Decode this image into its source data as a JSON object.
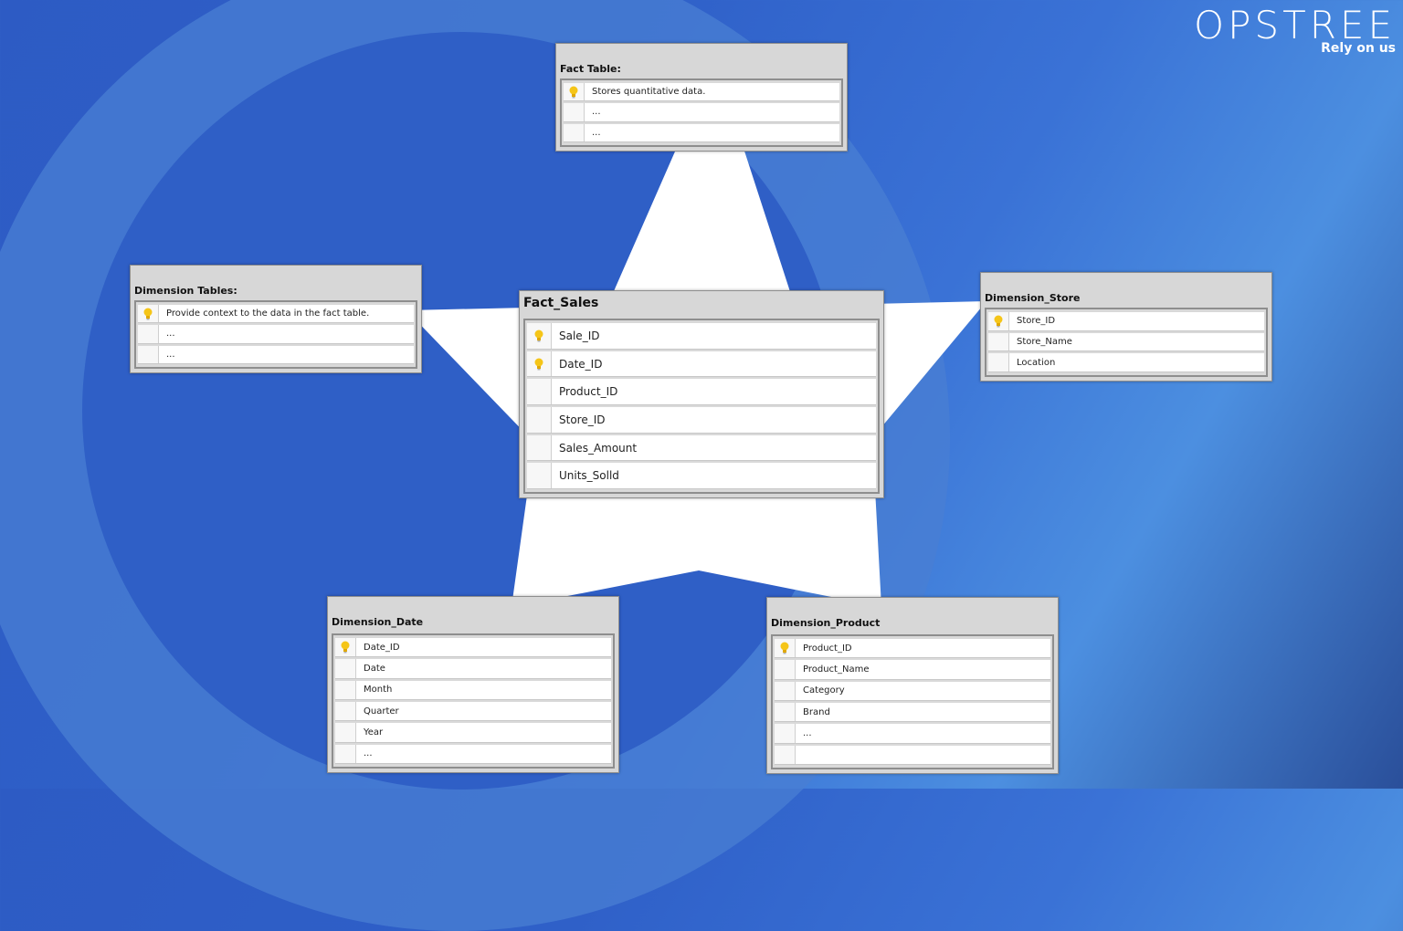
{
  "brand": {
    "name": "OPSTREE",
    "tagline": "Rely on us"
  },
  "diagram": {
    "fact_table_note": {
      "title": "Fact Table:",
      "rows": [
        {
          "key": true,
          "text": "Stores quantitative data."
        },
        {
          "key": false,
          "text": "..."
        },
        {
          "key": false,
          "text": "..."
        }
      ]
    },
    "dimension_tables_note": {
      "title": "Dimension Tables:",
      "rows": [
        {
          "key": true,
          "text": "Provide context to the data in the fact table."
        },
        {
          "key": false,
          "text": "..."
        },
        {
          "key": false,
          "text": "..."
        }
      ]
    },
    "fact_sales": {
      "title": "Fact_Sales",
      "rows": [
        {
          "key": true,
          "text": "Sale_ID"
        },
        {
          "key": true,
          "text": "Date_ID"
        },
        {
          "key": false,
          "text": "Product_ID"
        },
        {
          "key": false,
          "text": "Store_ID"
        },
        {
          "key": false,
          "text": "Sales_Amount"
        },
        {
          "key": false,
          "text": "Units_Solld"
        }
      ]
    },
    "dimension_store": {
      "title": "Dimension_Store",
      "rows": [
        {
          "key": true,
          "text": "Store_ID"
        },
        {
          "key": false,
          "text": "Store_Name"
        },
        {
          "key": false,
          "text": "Location"
        }
      ]
    },
    "dimension_date": {
      "title": "Dimension_Date",
      "rows": [
        {
          "key": true,
          "text": "Date_ID"
        },
        {
          "key": false,
          "text": "Date"
        },
        {
          "key": false,
          "text": "Month"
        },
        {
          "key": false,
          "text": "Quarter"
        },
        {
          "key": false,
          "text": "Year"
        },
        {
          "key": false,
          "text": "..."
        }
      ]
    },
    "dimension_product": {
      "title": "Dimension_Product",
      "rows": [
        {
          "key": true,
          "text": "Product_ID"
        },
        {
          "key": false,
          "text": "Product_Name"
        },
        {
          "key": false,
          "text": "Category"
        },
        {
          "key": false,
          "text": "Brand"
        },
        {
          "key": false,
          "text": "..."
        },
        {
          "key": false,
          "text": ""
        }
      ]
    }
  },
  "icons": {
    "key": "lightbulb-icon"
  },
  "colors": {
    "background": "#2f60c8",
    "star": "#ffffff",
    "table_header": "#d7d7d7",
    "key_icon": "#f2c200"
  }
}
